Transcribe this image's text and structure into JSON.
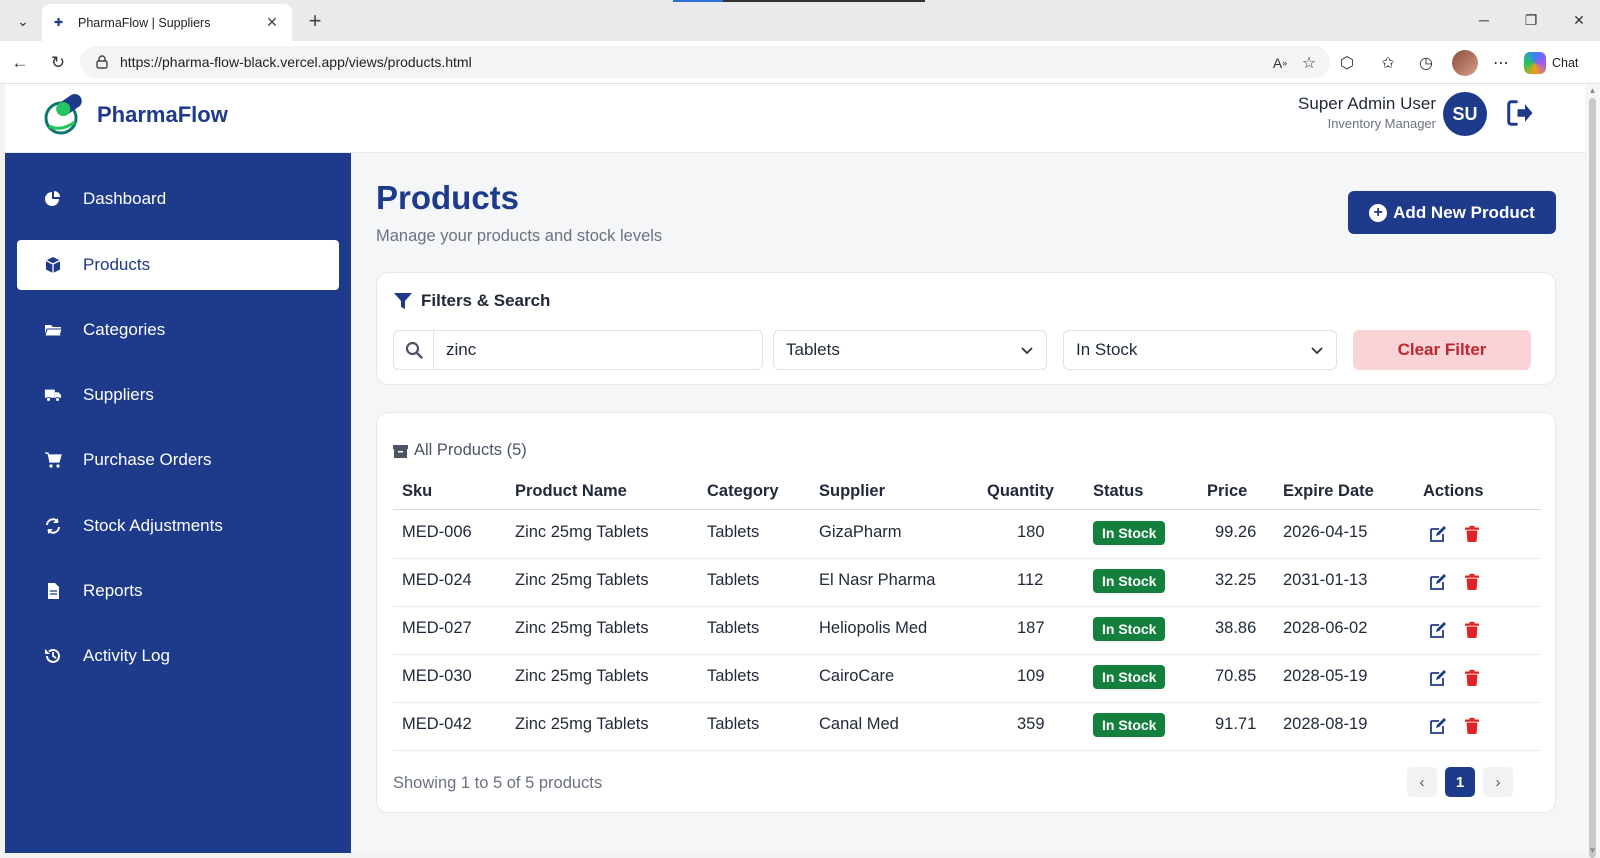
{
  "browser": {
    "tab_title": "PharmaFlow | Suppliers",
    "url": "https://pharma-flow-black.vercel.app/views/products.html",
    "chat_label": "Chat"
  },
  "header": {
    "brand": "PharmaFlow",
    "user_name": "Super Admin User",
    "user_role": "Inventory Manager",
    "avatar_initials": "SU"
  },
  "sidebar": {
    "items": [
      {
        "label": "Dashboard",
        "icon": "pie-chart-icon"
      },
      {
        "label": "Products",
        "icon": "box-icon",
        "active": true
      },
      {
        "label": "Categories",
        "icon": "folder-icon"
      },
      {
        "label": "Suppliers",
        "icon": "truck-icon"
      },
      {
        "label": "Purchase Orders",
        "icon": "cart-icon"
      },
      {
        "label": "Stock Adjustments",
        "icon": "sync-icon"
      },
      {
        "label": "Reports",
        "icon": "file-icon"
      },
      {
        "label": "Activity Log",
        "icon": "history-icon"
      }
    ]
  },
  "page": {
    "title": "Products",
    "subtitle": "Manage your products and stock levels",
    "add_button": "Add New Product"
  },
  "filters": {
    "title": "Filters & Search",
    "search_value": "zinc",
    "category_selected": "Tablets",
    "status_selected": "In Stock",
    "clear_label": "Clear Filter"
  },
  "table": {
    "title": "All Products (5)",
    "columns": [
      "Sku",
      "Product Name",
      "Category",
      "Supplier",
      "Quantity",
      "Status",
      "Price",
      "Expire Date",
      "Actions"
    ],
    "rows": [
      {
        "sku": "MED-006",
        "name": "Zinc 25mg Tablets",
        "category": "Tablets",
        "supplier": "GizaPharm",
        "quantity": "180",
        "status": "In Stock",
        "price": "99.26",
        "expire": "2026-04-15"
      },
      {
        "sku": "MED-024",
        "name": "Zinc 25mg Tablets",
        "category": "Tablets",
        "supplier": "El Nasr Pharma",
        "quantity": "112",
        "status": "In Stock",
        "price": "32.25",
        "expire": "2031-01-13"
      },
      {
        "sku": "MED-027",
        "name": "Zinc 25mg Tablets",
        "category": "Tablets",
        "supplier": "Heliopolis Med",
        "quantity": "187",
        "status": "In Stock",
        "price": "38.86",
        "expire": "2028-06-02"
      },
      {
        "sku": "MED-030",
        "name": "Zinc 25mg Tablets",
        "category": "Tablets",
        "supplier": "CairoCare",
        "quantity": "109",
        "status": "In Stock",
        "price": "70.85",
        "expire": "2028-05-19"
      },
      {
        "sku": "MED-042",
        "name": "Zinc 25mg Tablets",
        "category": "Tablets",
        "supplier": "Canal Med",
        "quantity": "359",
        "status": "In Stock",
        "price": "91.71",
        "expire": "2028-08-19"
      }
    ],
    "footer": "Showing 1 to 5 of 5 products",
    "current_page": "1"
  },
  "colors": {
    "primary": "#1e3a8a",
    "success": "#15803d",
    "danger": "#dc2626",
    "clear_bg": "#f9d3d6"
  }
}
